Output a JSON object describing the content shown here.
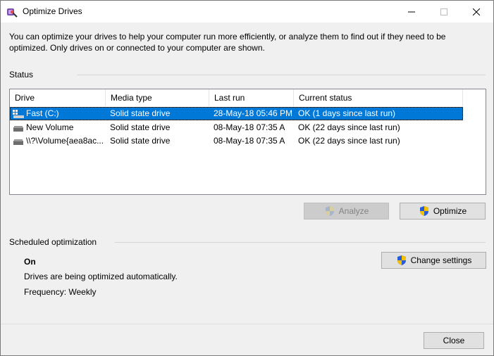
{
  "window": {
    "title": "Optimize Drives"
  },
  "intro_text": "You can optimize your drives to help your computer run more efficiently, or analyze them to find out if they need to be optimized. Only drives on or connected to your computer are shown.",
  "status": {
    "label": "Status",
    "columns": [
      "Drive",
      "Media type",
      "Last run",
      "Current status"
    ],
    "rows": [
      {
        "drive": "Fast (C:)",
        "media_type": "Solid state drive",
        "last_run": "28-May-18 05:46 PM",
        "current_status": "OK (1 days since last run)",
        "icon": "system-drive-icon"
      },
      {
        "drive": "New Volume",
        "media_type": "Solid state drive",
        "last_run": "08-May-18 07:35 A",
        "current_status": "OK (22 days since last run)",
        "icon": "drive-icon"
      },
      {
        "drive": "\\\\?\\Volume{aea8ac...",
        "media_type": "Solid state drive",
        "last_run": "08-May-18 07:35 A",
        "current_status": "OK (22 days since last run)",
        "icon": "drive-icon"
      }
    ],
    "analyze_label": "Analyze",
    "optimize_label": "Optimize"
  },
  "scheduled": {
    "label": "Scheduled optimization",
    "state": "On",
    "description": "Drives are being optimized automatically.",
    "frequency": "Frequency: Weekly",
    "change_settings_label": "Change settings"
  },
  "footer": {
    "close_label": "Close"
  },
  "colors": {
    "selection": "#0078d7",
    "shield_blue": "#2a5bd7",
    "shield_yellow": "#f2c200"
  }
}
